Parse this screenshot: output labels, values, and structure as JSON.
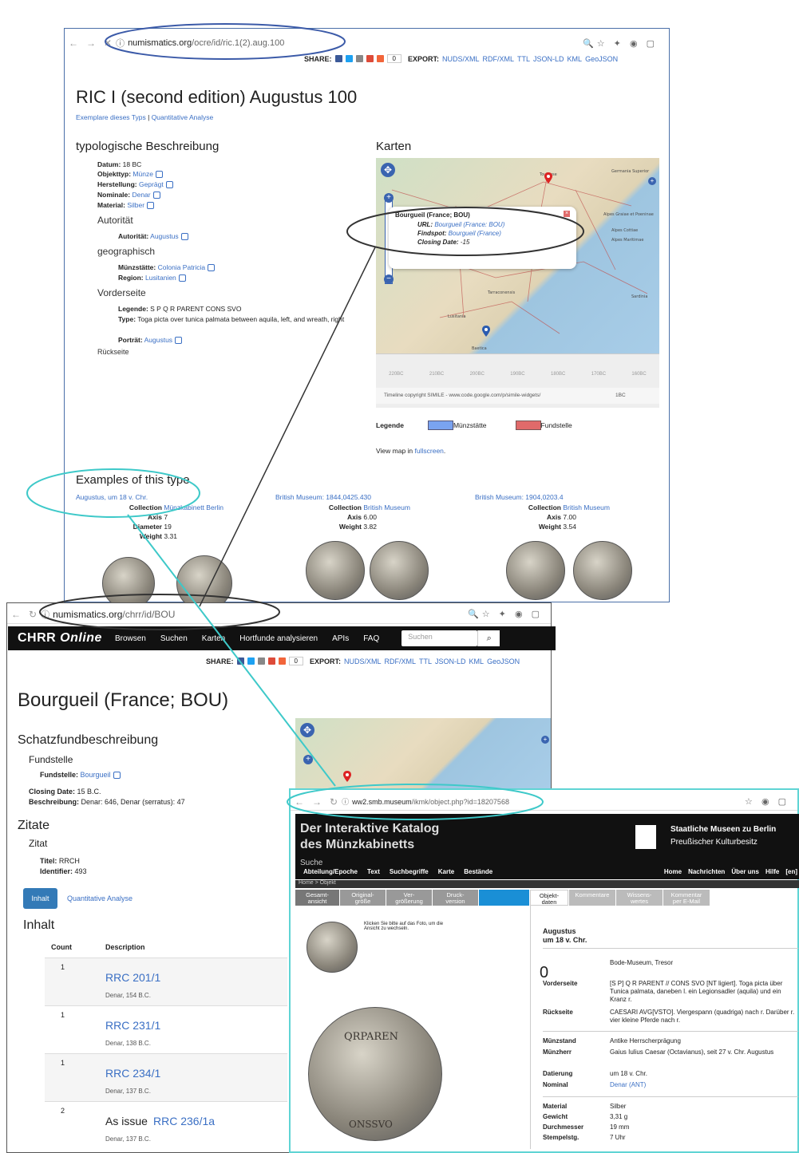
{
  "w1": {
    "url_host": "numismatics.org",
    "url_path": "/ocre/id/ric.1(2).aug.100",
    "share_label": "SHARE:",
    "share_count": "0",
    "export_label": "EXPORT:",
    "export_links": [
      "NUDS/XML",
      "RDF/XML",
      "TTL",
      "JSON-LD",
      "KML",
      "GeoJSON"
    ],
    "title": "RIC I (second edition) Augustus 100",
    "subtitle_links": [
      "Exemplare dieses Typs",
      "Quantitative Analyse"
    ],
    "subtitle_sep": "|",
    "typ_heading": "typologische Beschreibung",
    "fields": [
      {
        "k": "Datum:",
        "v": "18 BC",
        "link": false
      },
      {
        "k": "Objekttyp:",
        "v": "Münze",
        "link": true
      },
      {
        "k": "Herstellung:",
        "v": "Geprägt",
        "link": true
      },
      {
        "k": "Nominale:",
        "v": "Denar",
        "link": true
      },
      {
        "k": "Material:",
        "v": "Silber",
        "link": true
      }
    ],
    "autoritaet_heading": "Autorität",
    "autoritaet_k": "Autorität:",
    "autoritaet_v": "Augustus",
    "geo_heading": "geographisch",
    "muenz_k": "Münzstätte:",
    "muenz_v": "Colonia Patricia",
    "region_k": "Region:",
    "region_v": "Lusitanien",
    "vorder_heading": "Vorderseite",
    "legende_k": "Legende:",
    "legende_v": "S P Q R PARENT CONS SVO",
    "type_k": "Type:",
    "type_v": "Toga picta over tunica palmata between aquila, left, and wreath, right",
    "portrait_k": "Porträt:",
    "portrait_v": "Augustus",
    "cut_heading": "Rückseite",
    "karten_heading": "Karten",
    "popup": {
      "title": "Bourgueil (France; BOU)",
      "url_k": "URL:",
      "url_v": "Bourgueil (France: BOU)",
      "find_k": "Findspot:",
      "find_v": "Bourgueil (France)",
      "close_k": "Closing Date:",
      "close_v": "-15"
    },
    "map_places": [
      "Toulouse",
      "Germania Superior",
      "Alpes Graiae et Poeninae",
      "Alpes Cottiae",
      "Alpes Maritimae",
      "Tarraconensis",
      "Sardinia",
      "Lusitania",
      "Baetica"
    ],
    "timeline_ticks": [
      "220BC",
      "210BC",
      "200BC",
      "190BC",
      "180BC",
      "170BC",
      "160BC"
    ],
    "timeline_credit": "Timeline copyright SIMILE - www.code.google.com/p/simile-widgets/",
    "timeline_current": "1BC",
    "legend_label": "Legende",
    "legend_items": [
      {
        "name": "Münzstätte",
        "color": "#7aa3f0"
      },
      {
        "name": "Fundstelle",
        "color": "#e06a6a"
      }
    ],
    "view_map_pre": "View map in",
    "view_map_link": "fullscreen",
    "view_map_post": ".",
    "examples_heading": "Examples of this type",
    "examples": [
      {
        "title": "Augustus, um 18 v. Chr.",
        "rows": [
          [
            "Collection",
            "Münzkabinett Berlin",
            true
          ],
          [
            "Axis",
            "7",
            false
          ],
          [
            "Diameter",
            "19",
            false
          ],
          [
            "Weight",
            "3.31",
            false
          ]
        ]
      },
      {
        "title": "British Museum: 1844,0425.430",
        "rows": [
          [
            "Collection",
            "British Museum",
            true
          ],
          [
            "Axis",
            "6.00",
            false
          ],
          [
            "Weight",
            "3.82",
            false
          ]
        ]
      },
      {
        "title": "British Museum: 1904,0203.4",
        "rows": [
          [
            "Collection",
            "British Museum",
            true
          ],
          [
            "Axis",
            "7.00",
            false
          ],
          [
            "Weight",
            "3.54",
            false
          ]
        ]
      }
    ]
  },
  "w2": {
    "url_host": "numismatics.org",
    "url_path": "/chrr/id/BOU",
    "brand": "CHRR",
    "brand_italic": "Online",
    "nav": [
      "Browsen",
      "Suchen",
      "Karten",
      "Hortfunde analysieren",
      "APIs",
      "FAQ"
    ],
    "search_placeholder": "Suchen",
    "share_label": "SHARE:",
    "share_count": "0",
    "export_label": "EXPORT:",
    "export_links": [
      "NUDS/XML",
      "RDF/XML",
      "TTL",
      "JSON-LD",
      "KML",
      "GeoJSON"
    ],
    "title": "Bourgueil (France; BOU)",
    "schatz_heading": "Schatzfundbeschreibung",
    "fundstelle_heading": "Fundstelle",
    "fundstelle_k": "Fundstelle:",
    "fundstelle_v": "Bourgueil",
    "closing_k": "Closing Date:",
    "closing_v": "15 B.C.",
    "beschr_k": "Beschreibung:",
    "beschr_v": "Denar: 646, Denar (serratus): 47",
    "zitate_heading": "Zitate",
    "zitat_heading": "Zitat",
    "titel_k": "Titel:",
    "titel_v": "RRCH",
    "ident_k": "Identifier:",
    "ident_v": "493",
    "tab_inhalt": "Inhalt",
    "tab_quant": "Quantitative Analyse",
    "inhalt_heading": "Inhalt",
    "col_count": "Count",
    "col_desc": "Description",
    "rows": [
      {
        "count": "1",
        "prefix": "",
        "link": "RRC 201/1",
        "sub": "Denar, 154 B.C."
      },
      {
        "count": "1",
        "prefix": "",
        "link": "RRC 231/1",
        "sub": "Denar, 138 B.C."
      },
      {
        "count": "1",
        "prefix": "",
        "link": "RRC 234/1",
        "sub": "Denar, 137 B.C."
      },
      {
        "count": "2",
        "prefix": "As issue",
        "link": "RRC 236/1a",
        "sub": "Denar, 137 B.C."
      }
    ]
  },
  "w3": {
    "url_host": "ww2.smb.museum",
    "url_path": "/ikmk/object.php?id=18207568",
    "title1": "Der Interaktive Katalog",
    "title2": "des Münzkabinetts",
    "museum1": "Staatliche Museen zu Berlin",
    "museum2": "Preußischer Kulturbesitz",
    "search_label": "Suche",
    "menu": [
      "Abteilung/Epoche",
      "Text",
      "Suchbegriffe",
      "Karte",
      "Bestände"
    ],
    "right_menu": [
      "Home",
      "Nachrichten",
      "Über uns",
      "Hilfe",
      "[en]"
    ],
    "breadcrumb": "Home > Objekt",
    "tabs": [
      "Gesamt-\nansicht",
      "Original-\ngröße",
      "Ver-\ngrößerung",
      "Druck-\nversion"
    ],
    "tabs2": [
      "Objekt-\ndaten",
      "Kommentare",
      "Wissens-\nwertes",
      "Kommentar\nper E-Mail"
    ],
    "hint": "Klicken Sie bitte auf das Foto, um die Ansicht zu wechseln.",
    "obj_title1": "Augustus",
    "obj_title2": "um 18 v. Chr.",
    "location": "Bode-Museum, Tresor",
    "zero": "0",
    "details": [
      {
        "k": "Vorderseite",
        "v": "[S P] Q R PARENT // CONS SVO [NT ligiert]. Toga picta über Tunica palmata, daneben l. ein Legionsadler (aquila) und ein Kranz r."
      },
      {
        "k": "Rückseite",
        "v": "CAESARI AVG[VSTO]. Viergespann (quadriga) nach r. Darüber r. vier kleine Pferde nach r."
      },
      {
        "k": "Münzstand",
        "v": "Antike Herrscherprägung"
      },
      {
        "k": "Münzherr",
        "v": "Gaius Iulius Caesar (Octavianus), seit 27 v. Chr. Augustus"
      },
      {
        "k": "Datierung",
        "v": "um 18 v. Chr."
      },
      {
        "k": "Nominal",
        "v": "Denar (ANT)"
      },
      {
        "k": "Material",
        "v": "Silber"
      },
      {
        "k": "Gewicht",
        "v": "3,31 g"
      },
      {
        "k": "Durchmesser",
        "v": "19 mm"
      },
      {
        "k": "Stempelstg.",
        "v": "7 Uhr"
      }
    ],
    "coin_legend1": "QRPAREN",
    "coin_legend2": "ONSSVO"
  },
  "colors": {
    "annotation_blue": "#3b5aa8",
    "annotation_cyan": "#3ec9c9",
    "annotation_dark": "#333333",
    "link": "#3a6fc4"
  }
}
